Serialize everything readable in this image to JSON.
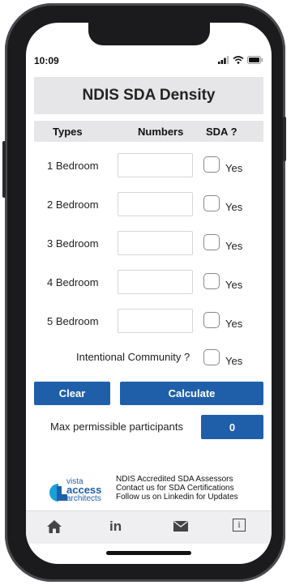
{
  "status": {
    "time": "10:09"
  },
  "header": {
    "title": "NDIS SDA Density"
  },
  "table": {
    "columns": [
      "Types",
      "Numbers",
      "SDA ?"
    ],
    "rows": [
      {
        "label": "1 Bedroom",
        "value": "",
        "check_label": "Yes"
      },
      {
        "label": "2 Bedroom",
        "value": "",
        "check_label": "Yes"
      },
      {
        "label": "3 Bedroom",
        "value": "",
        "check_label": "Yes"
      },
      {
        "label": "4 Bedroom",
        "value": "",
        "check_label": "Yes"
      },
      {
        "label": "5 Bedroom",
        "value": "",
        "check_label": "Yes"
      }
    ]
  },
  "community": {
    "label": "Intentional Community ?",
    "check_label": "Yes"
  },
  "actions": {
    "clear_label": "Clear",
    "calculate_label": "Calculate"
  },
  "result": {
    "label": "Max permissible participants",
    "value": "0"
  },
  "footer": {
    "logo_lines": [
      "vista",
      "access",
      "architects"
    ],
    "lines": [
      "NDIS Accredited SDA Assessors",
      "Contact us for SDA Certifications",
      "Follow us on Linkedin for Updates"
    ]
  },
  "tabs": [
    "home-icon",
    "linkedin-icon",
    "mail-icon",
    "info-icon"
  ],
  "tab_labels": {
    "linkedin": "in",
    "info": "i"
  },
  "colors": {
    "accent": "#1f5faa",
    "header_bg": "#e6e6e8",
    "logo_blue": "#1f5faa",
    "logo_cyan": "#18a0d8"
  }
}
